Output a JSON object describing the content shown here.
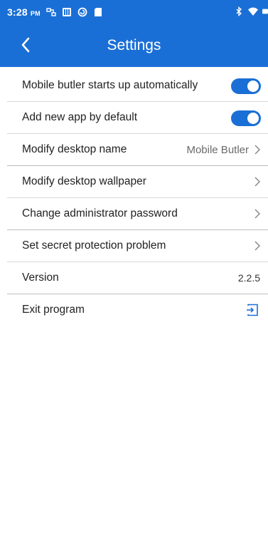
{
  "status_bar": {
    "time": "3:28",
    "meridiem": "PM",
    "icons": [
      "transfer-icon",
      "keyboard-icon",
      "sync-icon",
      "sd-card-icon",
      "bluetooth-icon",
      "wifi-icon",
      "battery-icon"
    ]
  },
  "header": {
    "title": "Settings",
    "back_icon": "chevron-left-icon"
  },
  "settings": {
    "autostart": {
      "label": "Mobile butler starts up automatically",
      "enabled": true
    },
    "add_new_app": {
      "label": "Add new app by default",
      "enabled": true
    },
    "desktop_name": {
      "label": "Modify desktop name",
      "value": "Mobile Butler"
    },
    "wallpaper": {
      "label": "Modify desktop wallpaper"
    },
    "admin_password": {
      "label": "Change administrator password"
    },
    "secret_problem": {
      "label": "Set secret protection problem"
    },
    "version": {
      "label": "Version",
      "value": "2.2.5"
    },
    "exit": {
      "label": "Exit program",
      "icon": "exit-icon"
    }
  },
  "colors": {
    "accent": "#1a6fd6",
    "divider": "#d8d8d8",
    "text": "#222222",
    "secondary_text": "#6a6a6a"
  }
}
